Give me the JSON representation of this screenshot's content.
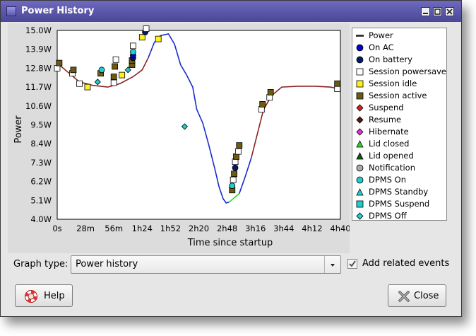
{
  "window": {
    "title": "Power History"
  },
  "legend": [
    {
      "label": "Power",
      "shape": "line",
      "color": "#1a1a1a"
    },
    {
      "label": "On AC",
      "shape": "circle",
      "color": "#0000cc"
    },
    {
      "label": "On battery",
      "shape": "circle",
      "color": "#001a66"
    },
    {
      "label": "Session powersave",
      "shape": "square",
      "color": "#ffffff"
    },
    {
      "label": "Session idle",
      "shape": "square",
      "color": "#ffee22"
    },
    {
      "label": "Session active",
      "shape": "square",
      "color": "#6b5a14"
    },
    {
      "label": "Suspend",
      "shape": "diamond",
      "color": "#cc2222"
    },
    {
      "label": "Resume",
      "shape": "diamond",
      "color": "#5a1414"
    },
    {
      "label": "Hibernate",
      "shape": "diamond",
      "color": "#dd33cc"
    },
    {
      "label": "Lid closed",
      "shape": "triangle",
      "color": "#33cc33"
    },
    {
      "label": "Lid opened",
      "shape": "triangle",
      "color": "#115511"
    },
    {
      "label": "Notification",
      "shape": "circle",
      "color": "#aaaaaa"
    },
    {
      "label": "DPMS On",
      "shape": "circle",
      "color": "#22cccc"
    },
    {
      "label": "DPMS Standby",
      "shape": "triangle",
      "color": "#22cccc"
    },
    {
      "label": "DPMS Suspend",
      "shape": "square",
      "color": "#22cccc"
    },
    {
      "label": "DPMS Off",
      "shape": "diamond",
      "color": "#22cccc"
    }
  ],
  "graph_type": {
    "label": "Graph type:",
    "value": "Power history"
  },
  "related": {
    "label": "Add related events",
    "checked": true
  },
  "buttons": {
    "help": "Help",
    "close": "Close"
  },
  "chart_data": {
    "type": "line",
    "xlabel": "Time since startup",
    "ylabel": "Power",
    "x_ticks": [
      "0s",
      "28m",
      "56m",
      "1h24",
      "1h52",
      "2h20",
      "2h48",
      "3h16",
      "3h44",
      "4h12",
      "4h40"
    ],
    "y_ticks": [
      "4.0W",
      "5.1W",
      "6.2W",
      "7.3W",
      "8.4W",
      "9.5W",
      "10.6W",
      "11.7W",
      "12.8W",
      "13.9W",
      "15.0W"
    ],
    "xlim_minutes": [
      0,
      280
    ],
    "ylim": [
      4.0,
      15.0
    ],
    "grid": true,
    "series": [
      {
        "color": "#8b2222",
        "points": [
          [
            0,
            13.1
          ],
          [
            10,
            12.6
          ],
          [
            22,
            12.0
          ],
          [
            35,
            11.8
          ],
          [
            50,
            11.7
          ],
          [
            62,
            11.9
          ],
          [
            75,
            12.3
          ],
          [
            84,
            12.7
          ],
          [
            90,
            13.4
          ]
        ]
      },
      {
        "color": "#1a2acc",
        "points": [
          [
            90,
            13.4
          ],
          [
            96,
            14.3
          ],
          [
            102,
            14.7
          ],
          [
            110,
            14.8
          ],
          [
            116,
            14.2
          ],
          [
            122,
            13.0
          ],
          [
            128,
            12.4
          ],
          [
            134,
            11.7
          ],
          [
            138,
            10.4
          ],
          [
            144,
            9.6
          ],
          [
            150,
            8.3
          ],
          [
            156,
            6.9
          ],
          [
            160,
            5.9
          ],
          [
            164,
            5.2
          ],
          [
            167,
            4.95
          ],
          [
            170,
            5.0
          ]
        ]
      },
      {
        "color": "#22dd22",
        "points": [
          [
            170,
            5.0
          ],
          [
            180,
            5.5
          ]
        ]
      },
      {
        "color": "#1a2acc",
        "points": [
          [
            180,
            5.5
          ],
          [
            186,
            6.5
          ],
          [
            192,
            7.6
          ]
        ]
      },
      {
        "color": "#8b2222",
        "points": [
          [
            192,
            7.6
          ],
          [
            198,
            9.0
          ],
          [
            204,
            10.4
          ],
          [
            212,
            11.2
          ],
          [
            222,
            11.7
          ],
          [
            238,
            11.75
          ],
          [
            255,
            11.75
          ],
          [
            270,
            11.7
          ],
          [
            279,
            11.6
          ]
        ]
      }
    ],
    "events": [
      {
        "t": 0,
        "w": 12.8,
        "kind": "Session powersave"
      },
      {
        "t": 2,
        "w": 13.1,
        "kind": "Session active"
      },
      {
        "t": 15,
        "w": 12.5,
        "kind": "Session powersave"
      },
      {
        "t": 16,
        "w": 12.7,
        "kind": "Session active"
      },
      {
        "t": 22,
        "w": 11.9,
        "kind": "Session powersave"
      },
      {
        "t": 30,
        "w": 11.7,
        "kind": "Session idle"
      },
      {
        "t": 40,
        "w": 12.0,
        "kind": "DPMS Off"
      },
      {
        "t": 43,
        "w": 12.5,
        "kind": "Session active"
      },
      {
        "t": 44,
        "w": 12.7,
        "kind": "DPMS On"
      },
      {
        "t": 56,
        "w": 12.3,
        "kind": "Session active"
      },
      {
        "t": 56,
        "w": 11.95,
        "kind": "Session powersave"
      },
      {
        "t": 57,
        "w": 12.9,
        "kind": "Session active"
      },
      {
        "t": 58,
        "w": 13.3,
        "kind": "Session powersave"
      },
      {
        "t": 64,
        "w": 12.4,
        "kind": "Session idle"
      },
      {
        "t": 70,
        "w": 12.7,
        "kind": "DPMS Off"
      },
      {
        "t": 74,
        "w": 13.0,
        "kind": "Session active"
      },
      {
        "t": 74,
        "w": 13.25,
        "kind": "Session active"
      },
      {
        "t": 75,
        "w": 13.4,
        "kind": "On battery"
      },
      {
        "t": 75,
        "w": 13.55,
        "kind": "On AC"
      },
      {
        "t": 75,
        "w": 13.75,
        "kind": "DPMS On"
      },
      {
        "t": 75,
        "w": 14.1,
        "kind": "Session powersave"
      },
      {
        "t": 84,
        "w": 14.6,
        "kind": "Session idle"
      },
      {
        "t": 87,
        "w": 14.9,
        "kind": "On battery"
      },
      {
        "t": 88,
        "w": 15.1,
        "kind": "Session powersave"
      },
      {
        "t": 100,
        "w": 14.5,
        "kind": "Session idle"
      },
      {
        "t": 126,
        "w": 9.4,
        "kind": "DPMS Off"
      },
      {
        "t": 173,
        "w": 5.7,
        "kind": "Session active"
      },
      {
        "t": 173,
        "w": 5.95,
        "kind": "DPMS On"
      },
      {
        "t": 174,
        "w": 6.3,
        "kind": "Session powersave"
      },
      {
        "t": 175,
        "w": 6.65,
        "kind": "Session active"
      },
      {
        "t": 176,
        "w": 7.0,
        "kind": "On battery"
      },
      {
        "t": 176,
        "w": 7.35,
        "kind": "Session powersave"
      },
      {
        "t": 177,
        "w": 7.65,
        "kind": "Session active"
      },
      {
        "t": 179,
        "w": 7.95,
        "kind": "Session powersave"
      },
      {
        "t": 180,
        "w": 8.3,
        "kind": "Session active"
      },
      {
        "t": 202,
        "w": 10.4,
        "kind": "Session powersave"
      },
      {
        "t": 203,
        "w": 10.7,
        "kind": "Session active"
      },
      {
        "t": 210,
        "w": 11.1,
        "kind": "Session powersave"
      },
      {
        "t": 211,
        "w": 11.4,
        "kind": "Session active"
      },
      {
        "t": 277,
        "w": 11.6,
        "kind": "Session powersave"
      },
      {
        "t": 277,
        "w": 11.9,
        "kind": "Session active"
      }
    ]
  }
}
